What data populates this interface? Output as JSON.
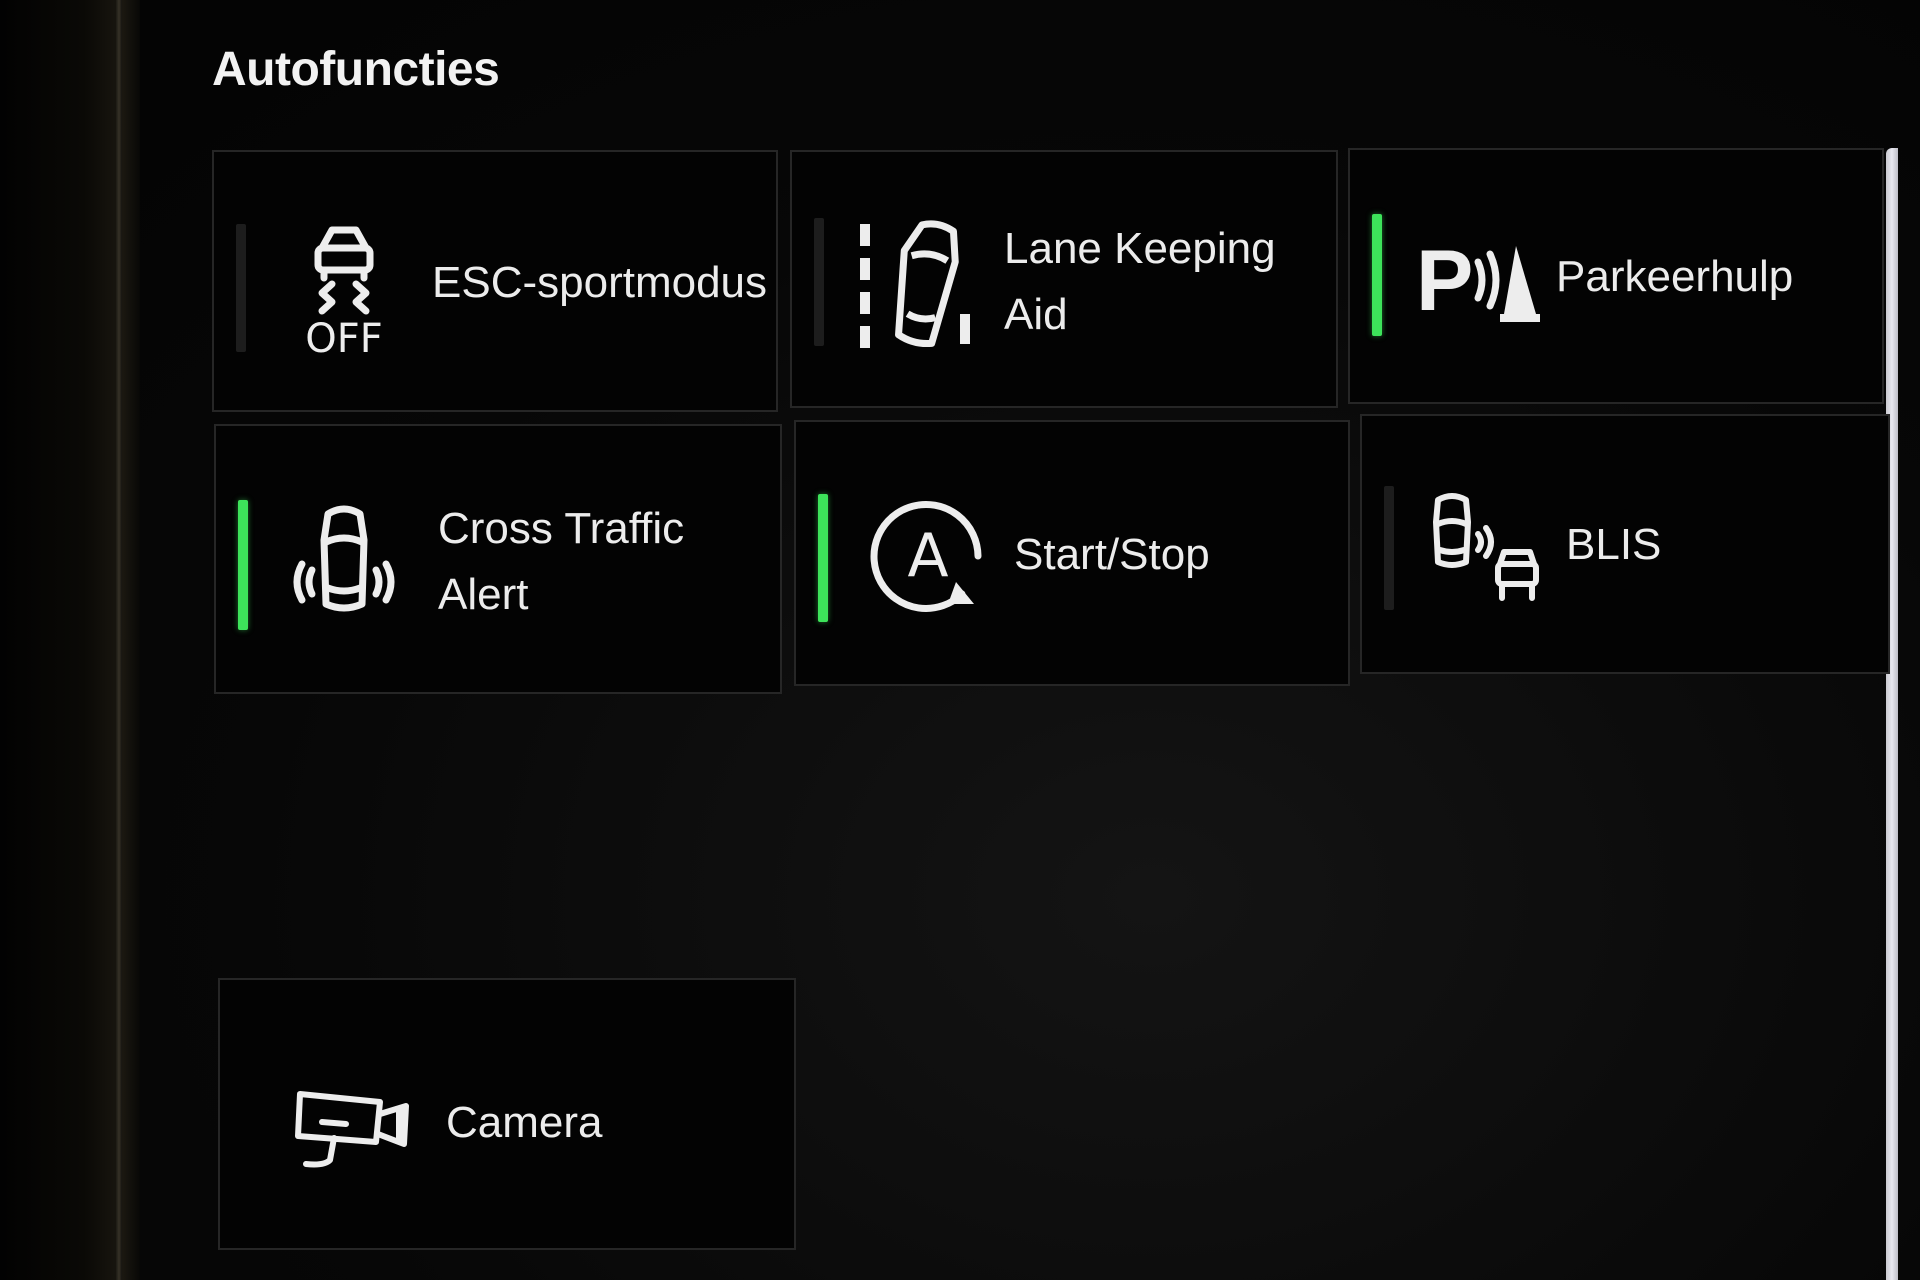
{
  "screen": {
    "title": "Autofuncties"
  },
  "tiles": [
    {
      "id": "esc",
      "label_lines": [
        "ESC-sportmodus"
      ],
      "icon": "esc-off-icon",
      "icon_text": "OFF",
      "active": false
    },
    {
      "id": "lane",
      "label_lines": [
        "Lane Keeping",
        "Aid"
      ],
      "icon": "lane-keeping-icon",
      "active": false
    },
    {
      "id": "park",
      "label_lines": [
        "Parkeerhulp"
      ],
      "icon": "park-assist-icon",
      "active": true
    },
    {
      "id": "cta",
      "label_lines": [
        "Cross Traffic",
        "Alert"
      ],
      "icon": "cross-traffic-icon",
      "active": true
    },
    {
      "id": "startstop",
      "label_lines": [
        "Start/Stop"
      ],
      "icon": "auto-start-stop-icon",
      "icon_text": "A",
      "active": true
    },
    {
      "id": "blis",
      "label_lines": [
        "BLIS"
      ],
      "icon": "blind-spot-icon",
      "active": false
    },
    {
      "id": "camera",
      "label_lines": [
        "Camera"
      ],
      "icon": "camera-icon",
      "active": null
    }
  ],
  "colors": {
    "indicator_on": "#3de35a",
    "indicator_off": "#1d1d1d",
    "tile_border": "#262626",
    "text": "#ececec"
  }
}
